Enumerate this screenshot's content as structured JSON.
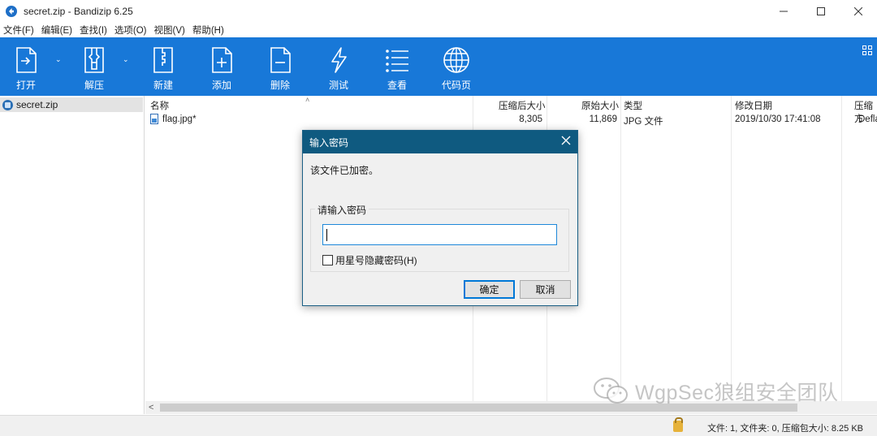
{
  "window": {
    "title": "secret.zip - Bandizip 6.25",
    "minimize": "—",
    "maximize": "☐",
    "close": "✕"
  },
  "menu": [
    "文件(F)",
    "编辑(E)",
    "查找(I)",
    "选项(O)",
    "视图(V)",
    "帮助(H)"
  ],
  "toolbar": {
    "open": "打开",
    "extract": "解压",
    "new": "新建",
    "add": "添加",
    "delete": "删除",
    "test": "测试",
    "view": "查看",
    "codepage": "代码页",
    "accent_color": "#1878d8"
  },
  "tree": {
    "root": "secret.zip"
  },
  "filelist": {
    "columns": [
      "名称",
      "压缩后大小",
      "原始大小",
      "类型",
      "修改日期",
      "压缩方"
    ],
    "rows": [
      {
        "name": "flag.jpg*",
        "packed": "8,305",
        "size": "11,869",
        "type": "JPG 文件",
        "modified": "2019/10/30 17:41:08",
        "method": "Defla"
      }
    ]
  },
  "scrollbar": {
    "left_arrow": "<"
  },
  "status": {
    "text": "文件: 1, 文件夹: 0, 压缩包大小: 8.25 KB"
  },
  "dialog": {
    "title": "输入密码",
    "message": "该文件已加密。",
    "group_label": "请输入密码",
    "password_value": "",
    "hide_checkbox_label": "用星号隐藏密码(H)",
    "ok": "确定",
    "cancel": "取消"
  },
  "watermark": {
    "text": "WgpSec狼组安全团队"
  }
}
